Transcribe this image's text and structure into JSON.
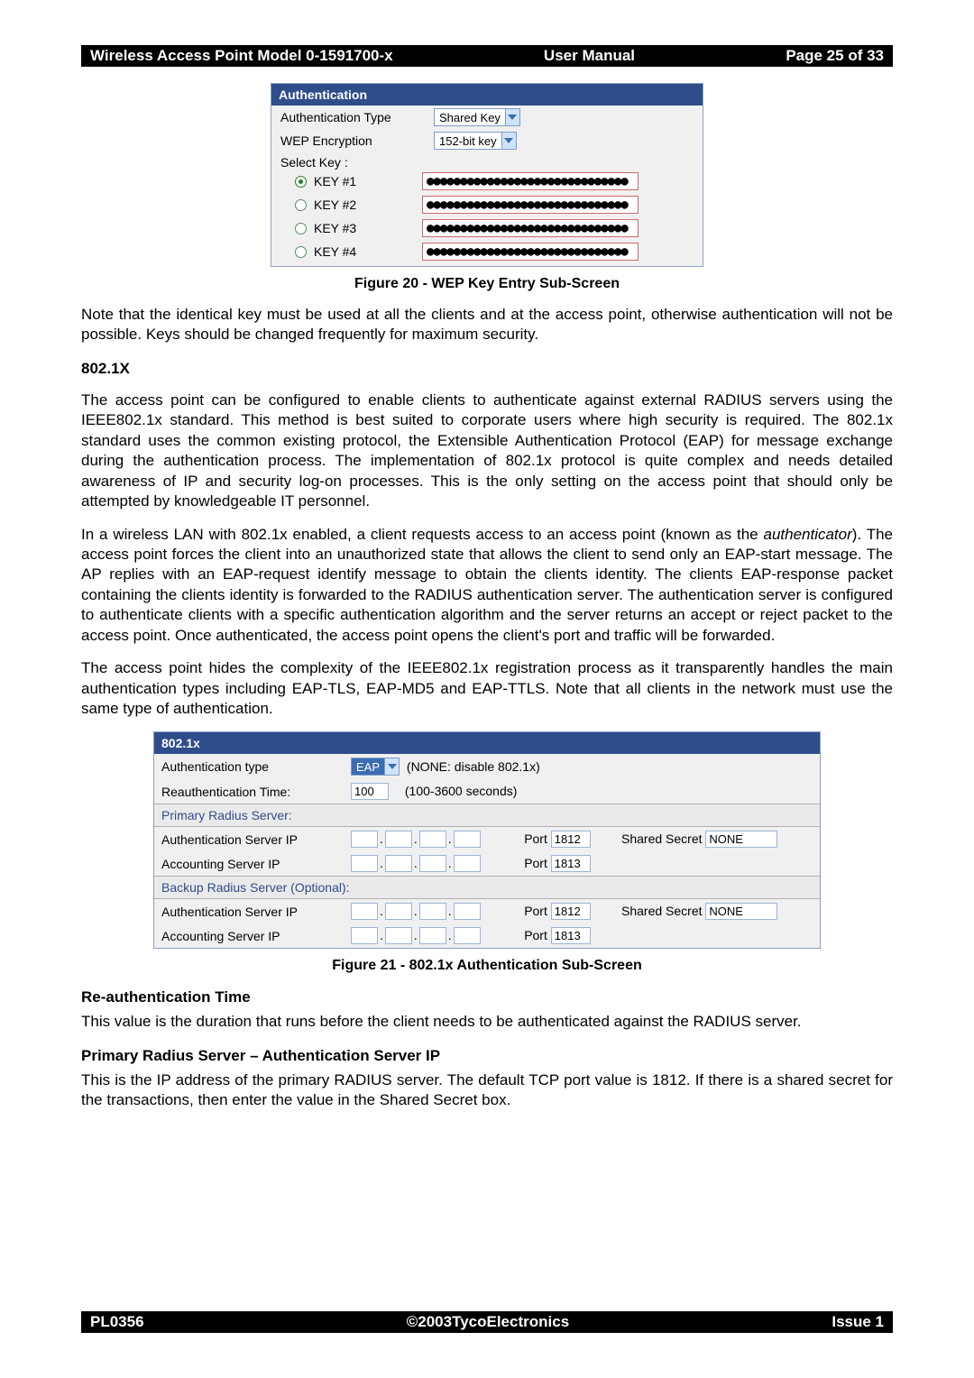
{
  "header": {
    "left": "Wireless Access Point  Model 0-1591700-x",
    "mid": "User Manual",
    "right": "Page 25 of 33"
  },
  "fig20": {
    "title": "Authentication",
    "auth_type_label": "Authentication Type",
    "auth_type_value": "Shared Key",
    "wep_label": "WEP Encryption",
    "wep_value": "152-bit key",
    "select_key_label": "Select Key :",
    "keys": [
      {
        "label": "KEY #1",
        "selected": true,
        "mask": "●●●●●●●●●●●●●●●●●●●●●●●●●●●●●●"
      },
      {
        "label": "KEY #2",
        "selected": false,
        "mask": "●●●●●●●●●●●●●●●●●●●●●●●●●●●●●●"
      },
      {
        "label": "KEY #3",
        "selected": false,
        "mask": "●●●●●●●●●●●●●●●●●●●●●●●●●●●●●●"
      },
      {
        "label": "KEY #4",
        "selected": false,
        "mask": "●●●●●●●●●●●●●●●●●●●●●●●●●●●●●●"
      }
    ],
    "caption": "Figure 20 - WEP Key Entry Sub-Screen"
  },
  "para_after_fig20": "Note that the identical key must be used at all the clients and at the access point, otherwise authentication will not be possible. Keys should be changed frequently for maximum security.",
  "h_8021x": "802.1X",
  "para_8021x_1": "The access point can be configured to enable clients to authenticate against external RADIUS servers using the IEEE802.1x standard. This method is best suited to corporate users where high security is required. The 802.1x standard uses the common existing protocol, the Extensible Authentication Protocol (EAP) for message exchange during the authentication process. The implementation of 802.1x protocol is quite complex and needs detailed awareness of IP and security log-on processes. This is the only setting on the access point that should only be attempted by knowledgeable IT personnel.",
  "para_8021x_2_pre": "In a wireless LAN with 802.1x enabled, a client requests access to an access point (known as the ",
  "para_8021x_2_italic": "authenticator",
  "para_8021x_2_post": "). The access point forces the client into an unauthorized state that allows the client to send only an EAP-start message. The AP replies with an EAP-request identify message to obtain the clients identity. The clients EAP-response packet containing the clients identity is forwarded to the RADIUS authentication server. The authentication server is configured to authenticate clients with a specific authentication algorithm and the server returns an accept or reject packet to the access point. Once authenticated, the access point opens the client's port and traffic will be forwarded.",
  "para_8021x_3": "The access point hides the complexity of the IEEE802.1x registration process as it transparently handles the main authentication types including EAP-TLS, EAP-MD5 and EAP-TTLS. Note that all clients in the network must use the same type of authentication.",
  "fig21": {
    "title": "802.1x",
    "auth_type_label": "Authentication type",
    "auth_type_value": "EAP",
    "auth_type_note": "(NONE: disable 802.1x)",
    "reauth_label": "Reauthentication Time:",
    "reauth_value": "100",
    "reauth_note": "(100-3600 seconds)",
    "primary_header": "Primary Radius Server:",
    "backup_header": "Backup Radius Server (Optional):",
    "lbl_auth_server": "Authentication Server IP",
    "lbl_acct_server": "Accounting Server IP",
    "lbl_port": "Port",
    "lbl_shared": "Shared Secret",
    "primary_auth_port": "1812",
    "primary_acct_port": "1813",
    "primary_secret": "NONE",
    "backup_auth_port": "1812",
    "backup_acct_port": "1813",
    "backup_secret": "NONE",
    "caption": "Figure 21 - 802.1x Authentication Sub-Screen"
  },
  "h_reauth": "Re-authentication Time",
  "para_reauth": "This value is the duration that runs before the client needs to be authenticated against the RADIUS server.",
  "h_primary_auth": "Primary Radius Server – Authentication Server IP",
  "para_primary_auth": "This is the IP address of the primary RADIUS server. The default TCP port value is 1812. If there is a shared secret for the transactions, then enter the value in the Shared Secret box.",
  "footer": {
    "left": "PL0356",
    "mid": "©2003TycoElectronics",
    "right": "Issue 1"
  }
}
